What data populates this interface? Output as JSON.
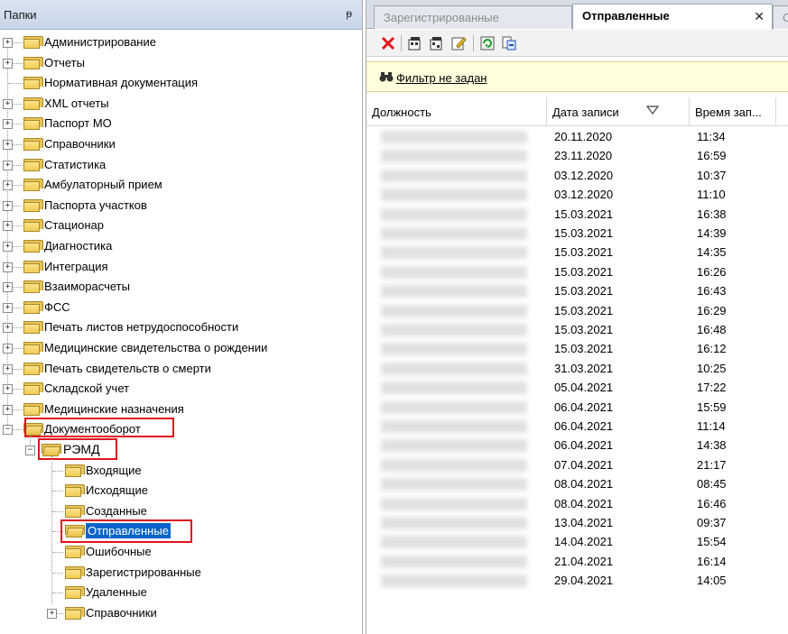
{
  "folders_panel": {
    "title": "Папки",
    "pin_glyph": "ᵽ",
    "items": [
      {
        "label": "Администрирование"
      },
      {
        "label": "Отчеты"
      },
      {
        "label": "Нормативная документация"
      },
      {
        "label": "XML отчеты"
      },
      {
        "label": "Паспорт МО"
      },
      {
        "label": "Справочники"
      },
      {
        "label": "Статистика"
      },
      {
        "label": "Амбулаторный прием"
      },
      {
        "label": "Паспорта участков"
      },
      {
        "label": "Стационар"
      },
      {
        "label": "Диагностика"
      },
      {
        "label": "Интеграция"
      },
      {
        "label": "Взаиморасчеты"
      },
      {
        "label": "ФСС"
      },
      {
        "label": "Печать листов нетрудоспособности"
      },
      {
        "label": "Медицинские свидетельства о рождении"
      },
      {
        "label": "Печать свидетельств о смерти"
      },
      {
        "label": "Складской учет"
      },
      {
        "label": "Медицинские назначения"
      },
      {
        "label": "Документооборот"
      }
    ],
    "remd": {
      "label": "РЭМД",
      "children": [
        {
          "label": "Входящие"
        },
        {
          "label": "Исходящие"
        },
        {
          "label": "Созданные"
        },
        {
          "label": "Отправленные"
        },
        {
          "label": "Ошибочные"
        },
        {
          "label": "Зарегистрированные"
        },
        {
          "label": "Удаленные"
        },
        {
          "label": "Справочники"
        }
      ]
    }
  },
  "tabs": [
    {
      "label": "Зарегистрированные"
    },
    {
      "label": "Отправленные"
    },
    {
      "label": "С"
    }
  ],
  "tab_close_glyph": "✕",
  "filter": {
    "label": "Фильтр не задан"
  },
  "grid": {
    "columns": [
      "Должность",
      "Дата записи",
      "Время зап..."
    ],
    "rows": [
      {
        "date": "20.11.2020",
        "time": "11:34"
      },
      {
        "date": "23.11.2020",
        "time": "16:59"
      },
      {
        "date": "03.12.2020",
        "time": "10:37"
      },
      {
        "date": "03.12.2020",
        "time": "11:10"
      },
      {
        "date": "15.03.2021",
        "time": "16:38"
      },
      {
        "date": "15.03.2021",
        "time": "14:39"
      },
      {
        "date": "15.03.2021",
        "time": "14:35"
      },
      {
        "date": "15.03.2021",
        "time": "16:26"
      },
      {
        "date": "15.03.2021",
        "time": "16:43"
      },
      {
        "date": "15.03.2021",
        "time": "16:29"
      },
      {
        "date": "15.03.2021",
        "time": "16:48"
      },
      {
        "date": "15.03.2021",
        "time": "16:12"
      },
      {
        "date": "31.03.2021",
        "time": "10:25"
      },
      {
        "date": "05.04.2021",
        "time": "17:22"
      },
      {
        "date": "06.04.2021",
        "time": "15:59"
      },
      {
        "date": "06.04.2021",
        "time": "11:14"
      },
      {
        "date": "06.04.2021",
        "time": "14:38"
      },
      {
        "date": "07.04.2021",
        "time": "21:17"
      },
      {
        "date": "08.04.2021",
        "time": "08:45"
      },
      {
        "date": "08.04.2021",
        "time": "16:46"
      },
      {
        "date": "13.04.2021",
        "time": "09:37"
      },
      {
        "date": "14.04.2021",
        "time": "15:54"
      },
      {
        "date": "21.04.2021",
        "time": "16:14"
      },
      {
        "date": "29.04.2021",
        "time": "14:05"
      }
    ]
  },
  "colors": {
    "selection": "#0a64c8",
    "highlight_box": "#e0141e",
    "filter_bg": "#ffffdc"
  }
}
